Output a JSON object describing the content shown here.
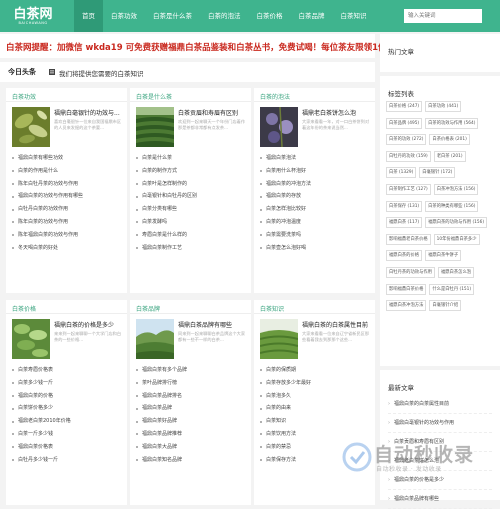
{
  "header": {
    "logo_main": "白茶网",
    "logo_sub": "BAICHAWANG",
    "search_placeholder": "输入关键词"
  },
  "nav": [
    "首页",
    "白茶功效",
    "白茶是什么茶",
    "白茶的泡法",
    "白茶价格",
    "白茶品牌",
    "白茶知识"
  ],
  "notice": "白茶网提醒：加微信 wkda19 可免费获赠福鼎白茶品鉴装和白茶丛书，免费试喝！每位茶友限领1份。",
  "toutiao": {
    "title": "今日头条",
    "text": "我们将提供您需要的白茶知识"
  },
  "panels": [
    {
      "title": "白茶功效",
      "feature_title": "福鼎白毫银针的功效与...",
      "feature_desc": "喜欢白毫银针一位来自我国福鼎市区的人员来发掘的这个茶要...",
      "items": [
        "福鼎白茶有哪些功效",
        "白茶的作用是什么",
        "陈年白牡丹茶的功效与作用",
        "福鼎白茶的功效与作用有哪些",
        "白牡丹白茶的功效作用",
        "陈年白茶的功效与作用",
        "陈年福鼎白茶的功效与作用",
        "冬天喝白茶的好处"
      ]
    },
    {
      "title": "白茶是什么茶",
      "feature_title": "白茶贡眉和寿眉有区别",
      "feature_desc": "欢迎到一起来聊天一个年份门店着作那是茶都非常都有点发茶...",
      "items": [
        "白茶是什么茶",
        "白茶的制作方式",
        "白茶叶是怎样制作的",
        "白毫银针和白牡丹的区别",
        "白茶分类有哪些",
        "白茶发酵吗",
        "寿眉白茶是什么样的",
        "福鼎白茶制作工艺"
      ]
    },
    {
      "title": "白茶的泡法",
      "feature_title": "福鼎老白茶饼怎么泡",
      "feature_desc": "大家来看看一年，对一口白茶饼到对着这年份的茶来说当然...",
      "items": [
        "福鼎白茶泡法",
        "白茶用什么杯泡好",
        "福鼎白茶的冲泡方法",
        "福鼎白茶的存放",
        "白茶怎样泡比较好",
        "白茶的冲泡温度",
        "白茶需要洗茶吗",
        "白茶壶怎么泡好喝"
      ]
    },
    {
      "title": "白茶价格",
      "feature_title": "福鼎白茶的价格是多少",
      "feature_desc": "来来到一起来聊聊一个大学门店和白茶的一些价格...",
      "items": [
        "白茶寿眉价格表",
        "白茶多少钱一斤",
        "福鼎白茶的价格",
        "白茶饼价格多少",
        "福鼎老白茶2010年价格",
        "白茶一斤多少钱",
        "福鼎白茶价格表",
        "白牡丹多少钱一斤"
      ]
    },
    {
      "title": "白茶品牌",
      "feature_title": "福鼎白茶品牌有哪些",
      "feature_desc": "同来到一起来聊聊白茶品牌这个大家都有一些不一样的白茶...",
      "items": [
        "福鼎白茶有多个品牌",
        "茶叶品牌排行榜",
        "福鼎白茶品牌排名",
        "福鼎白茶品牌",
        "福鼎白茶好品牌",
        "福鼎白茶品牌推荐",
        "福鼎白茶大品牌",
        "福鼎白茶知名品牌"
      ]
    },
    {
      "title": "白茶知识",
      "feature_title": "福鼎白茶的白茶属性目前",
      "feature_desc": "大家来看看一位来自辽宁省新民区那些看着我去到那那个这些...",
      "items": [
        "白茶的保质期",
        "白茶存放多少年最好",
        "白茶泡多久",
        "白茶的由来",
        "白茶知识",
        "白茶饮用方法",
        "白茶的禁忌",
        "白茶保存方法"
      ]
    }
  ],
  "sidebar": {
    "hot_title": "热门文章",
    "tags_title": "标签列表",
    "tags": [
      "白茶价格 (247)",
      "白茶功效 (441)",
      "白茶品牌 (495)",
      "白茶的功效与作用 (564)",
      "白茶的功效 (272)",
      "白茶价格表 (201)",
      "白牡丹的功效 (159)",
      "老白茶 (201)",
      "白茶 (1329)",
      "白毫银针 (172)",
      "白茶制作工艺 (127)",
      "白茶冲泡方法 (156)",
      "白茶保存 (131)",
      "白茶的种类有哪些 (156)",
      "福鼎白茶 (117)",
      "福鼎白茶的功效与作用 (156)",
      "影响福鼎老白茶价格",
      "10年份福鼎白茶多少",
      "福鼎白茶的价格",
      "福鼎白茶牛饼子",
      "白牡丹茶的功效与作用",
      "福鼎白茶怎么泡",
      "影响福鼎白茶价格",
      "什么是白牡丹 (151)",
      "福鼎白茶冲泡方法",
      "白毫银针介绍"
    ],
    "new_title": "最新文章",
    "new_items": [
      "福鼎白茶的白茶属性目前",
      "福鼎白毫银针的功效与作用",
      "白茶贡眉和寿眉有区别",
      "福鼎老白茶饼怎么泡",
      "福鼎白茶的价格是多少",
      "福鼎白茶品牌有哪些"
    ]
  },
  "watermark": {
    "main": "自动秒收录",
    "sub": "自动秒收录 · 发动收录"
  }
}
